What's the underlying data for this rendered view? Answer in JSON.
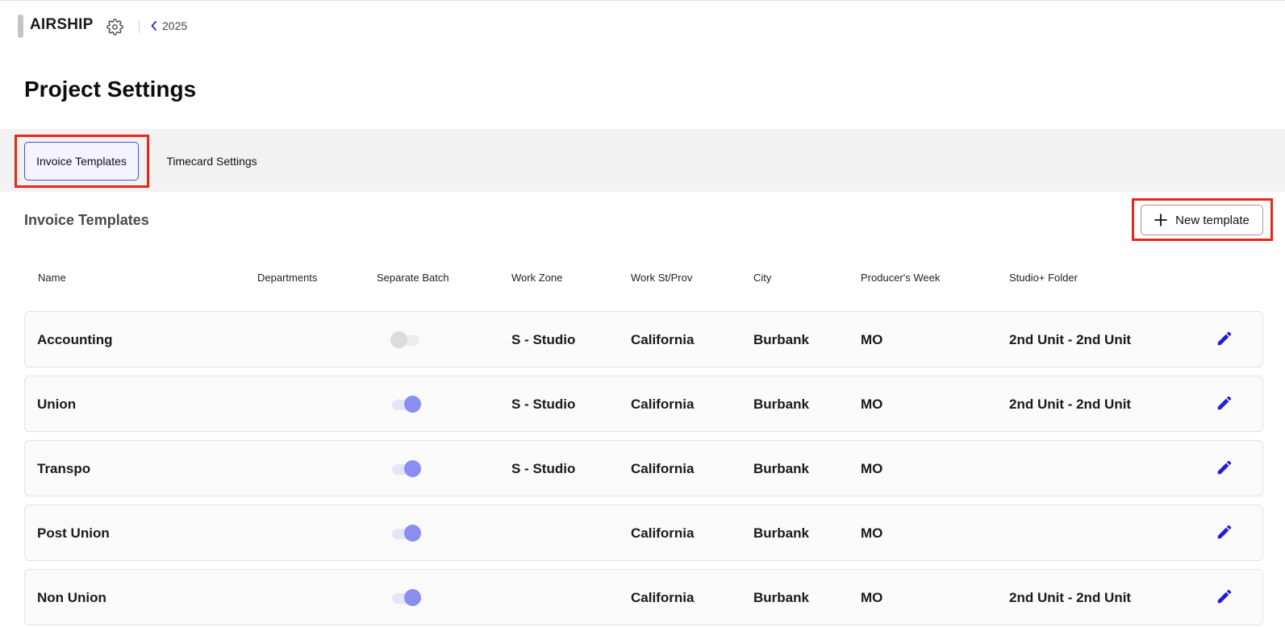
{
  "app": {
    "name": "AIRSHIP",
    "back_label": "2025"
  },
  "page": {
    "title": "Project Settings"
  },
  "tabs": [
    {
      "label": "Invoice Templates",
      "active": true
    },
    {
      "label": "Timecard Settings",
      "active": false
    }
  ],
  "section": {
    "title": "Invoice Templates",
    "new_button_label": "New template"
  },
  "table": {
    "columns": [
      "Name",
      "Departments",
      "Separate Batch",
      "Work Zone",
      "Work St/Prov",
      "City",
      "Producer's Week",
      "Studio+ Folder"
    ],
    "rows": [
      {
        "name": "Accounting",
        "departments": "",
        "separate_batch": false,
        "work_zone": "S - Studio",
        "work_state": "California",
        "city": "Burbank",
        "producers_week": "MO",
        "studio_folder": "2nd Unit - 2nd Unit"
      },
      {
        "name": "Union",
        "departments": "",
        "separate_batch": true,
        "work_zone": "S - Studio",
        "work_state": "California",
        "city": "Burbank",
        "producers_week": "MO",
        "studio_folder": "2nd Unit - 2nd Unit"
      },
      {
        "name": "Transpo",
        "departments": "",
        "separate_batch": true,
        "work_zone": "S - Studio",
        "work_state": "California",
        "city": "Burbank",
        "producers_week": "MO",
        "studio_folder": ""
      },
      {
        "name": "Post Union",
        "departments": "",
        "separate_batch": true,
        "work_zone": "",
        "work_state": "California",
        "city": "Burbank",
        "producers_week": "MO",
        "studio_folder": ""
      },
      {
        "name": "Non Union",
        "departments": "",
        "separate_batch": true,
        "work_zone": "",
        "work_state": "California",
        "city": "Burbank",
        "producers_week": "MO",
        "studio_folder": "2nd Unit - 2nd Unit"
      }
    ]
  },
  "colors": {
    "accent": "#4b54c8",
    "toggle_on": "#8a8ef0",
    "edit_icon": "#1f1fd6",
    "highlight": "#e8271a"
  },
  "icons": {
    "settings": "gear-icon",
    "back": "chevron-left-icon",
    "new": "plus-icon",
    "edit": "pencil-icon"
  }
}
